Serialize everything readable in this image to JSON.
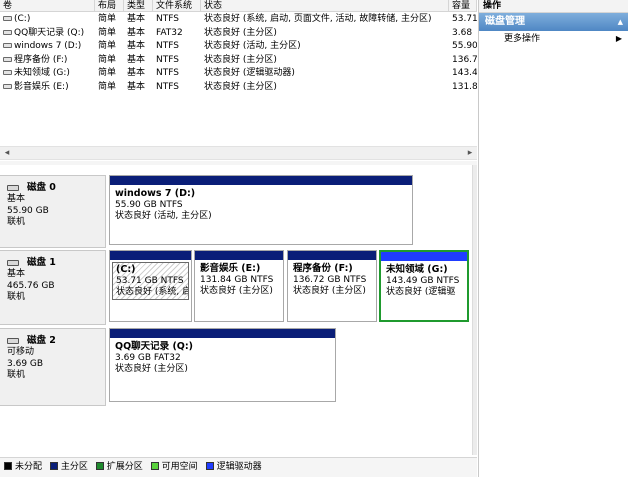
{
  "volume_table": {
    "columns": [
      "卷",
      "布局",
      "类型",
      "文件系统",
      "状态",
      "容量"
    ],
    "rows": [
      {
        "volume": "(C:)",
        "layout": "简单",
        "type": "基本",
        "fs": "NTFS",
        "status": "状态良好 (系统, 启动, 页面文件, 活动, 故障转储, 主分区)",
        "capacity": "53.71"
      },
      {
        "volume": "QQ聊天记录 (Q:)",
        "layout": "简单",
        "type": "基本",
        "fs": "FAT32",
        "status": "状态良好 (主分区)",
        "capacity": "3.68"
      },
      {
        "volume": "windows 7 (D:)",
        "layout": "简单",
        "type": "基本",
        "fs": "NTFS",
        "status": "状态良好 (活动, 主分区)",
        "capacity": "55.90"
      },
      {
        "volume": "程序备份 (F:)",
        "layout": "简单",
        "type": "基本",
        "fs": "NTFS",
        "status": "状态良好 (主分区)",
        "capacity": "136.7"
      },
      {
        "volume": "未知领域 (G:)",
        "layout": "简单",
        "type": "基本",
        "fs": "NTFS",
        "status": "状态良好 (逻辑驱动器)",
        "capacity": "143.4"
      },
      {
        "volume": "影音娱乐 (E:)",
        "layout": "简单",
        "type": "基本",
        "fs": "NTFS",
        "status": "状态良好 (主分区)",
        "capacity": "131.8"
      }
    ]
  },
  "disks": [
    {
      "name": "磁盘 0",
      "type": "基本",
      "size": "55.90 GB",
      "state": "联机",
      "partitions": [
        {
          "label": "windows 7  (D:)",
          "size_fs": "55.90 GB NTFS",
          "status": "状态良好 (活动, 主分区)"
        }
      ]
    },
    {
      "name": "磁盘 1",
      "type": "基本",
      "size": "465.76 GB",
      "state": "联机",
      "partitions": [
        {
          "label": "(C:)",
          "size_fs": "53.71 GB NTFS",
          "status": "状态良好 (系统, 启"
        },
        {
          "label": "影音娱乐  (E:)",
          "size_fs": "131.84 GB NTFS",
          "status": "状态良好 (主分区)"
        },
        {
          "label": "程序备份  (F:)",
          "size_fs": "136.72 GB NTFS",
          "status": "状态良好 (主分区)"
        },
        {
          "label": "未知领域  (G:)",
          "size_fs": "143.49 GB NTFS",
          "status": "状态良好 (逻辑驱"
        }
      ]
    },
    {
      "name": "磁盘 2",
      "type": "可移动",
      "size": "3.69 GB",
      "state": "联机",
      "partitions": [
        {
          "label": "QQ聊天记录  (Q:)",
          "size_fs": "3.69 GB FAT32",
          "status": "状态良好 (主分区)"
        }
      ]
    }
  ],
  "legend": [
    {
      "label": "未分配",
      "color": "#000000"
    },
    {
      "label": "主分区",
      "color": "#0a1e78"
    },
    {
      "label": "扩展分区",
      "color": "#1f8a2e"
    },
    {
      "label": "可用空间",
      "color": "#59d23c"
    },
    {
      "label": "逻辑驱动器",
      "color": "#1f3cff"
    }
  ],
  "actions": {
    "title": "操作",
    "section": "磁盘管理",
    "items": [
      {
        "label": "更多操作"
      }
    ]
  },
  "colors": {
    "primary_partition": "#0a1e78",
    "logical_drive": "#1f3cff",
    "selected_border": "#1f9a2e"
  },
  "icons": [
    "drive-icon",
    "disk-icon",
    "scroll-left-icon",
    "scroll-right-icon",
    "submenu-arrow-icon",
    "collapse-icon"
  ]
}
